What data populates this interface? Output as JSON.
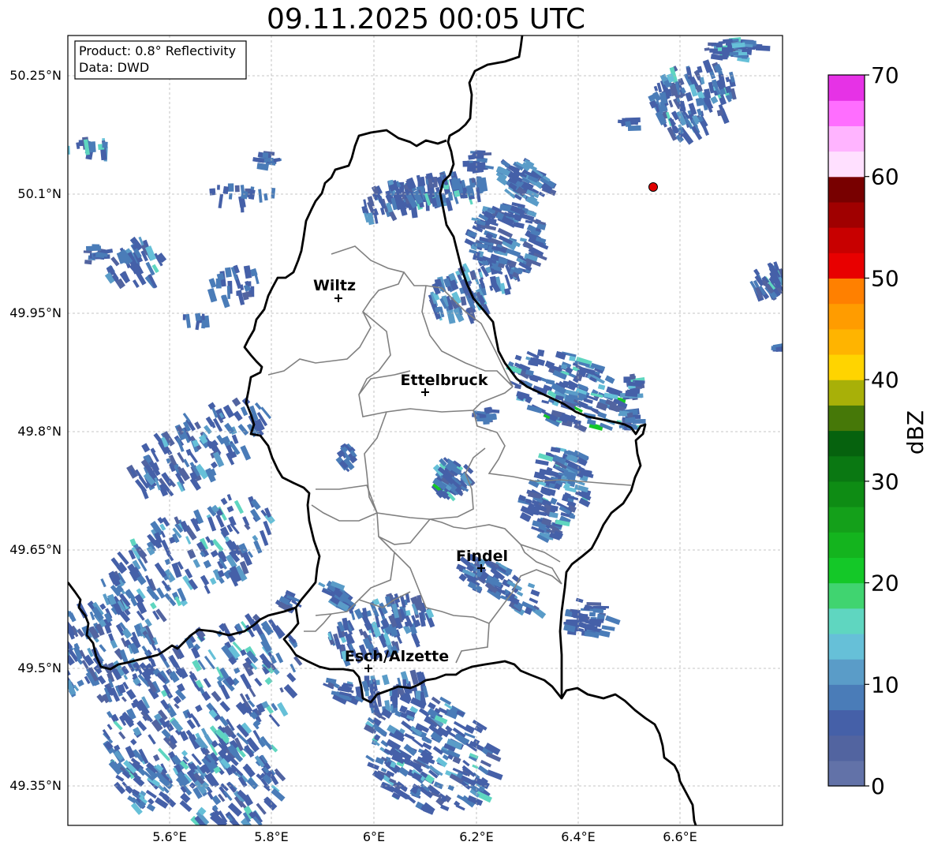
{
  "title": "09.11.2025 00:05 UTC",
  "info_box": {
    "line1": "Product: 0.8° Reflectivity",
    "line2": "Data: DWD"
  },
  "lat_labels": [
    "50.25°N",
    "50.1°N",
    "49.95°N",
    "49.8°N",
    "49.65°N",
    "49.5°N",
    "49.35°N"
  ],
  "lon_labels": [
    "5.6°E",
    "5.8°E",
    "6°E",
    "6.2°E",
    "6.4°E",
    "6.6°E"
  ],
  "cities": [
    {
      "name": "Wiltz",
      "lon": 5.93,
      "lat": 49.97
    },
    {
      "name": "Ettelbruck",
      "lon": 6.1,
      "lat": 49.85
    },
    {
      "name": "Findel",
      "lon": 6.21,
      "lat": 49.628
    },
    {
      "name": "Esch/Alzette",
      "lon": 5.99,
      "lat": 49.5
    }
  ],
  "radar_site": {
    "lon": 6.547,
    "lat": 50.11,
    "color": "#e00000"
  },
  "colorbar": {
    "label": "dBZ",
    "ticks": [
      "0",
      "10",
      "20",
      "30",
      "40",
      "50",
      "60",
      "70"
    ],
    "colors": [
      "#6272a8",
      "#5264a0",
      "#4560a8",
      "#4a7cb8",
      "#5a9cc8",
      "#66c0d8",
      "#5fd6c0",
      "#40d470",
      "#14c828",
      "#14b41e",
      "#14a01a",
      "#0e8c14",
      "#0a7812",
      "#06620e",
      "#467808",
      "#a8b008",
      "#ffd400",
      "#ffb400",
      "#ff9c00",
      "#ff8000",
      "#e80000",
      "#c80000",
      "#a00000",
      "#780000",
      "#ffe0ff",
      "#ffb4ff",
      "#ff6eff",
      "#e632e6"
    ]
  }
}
